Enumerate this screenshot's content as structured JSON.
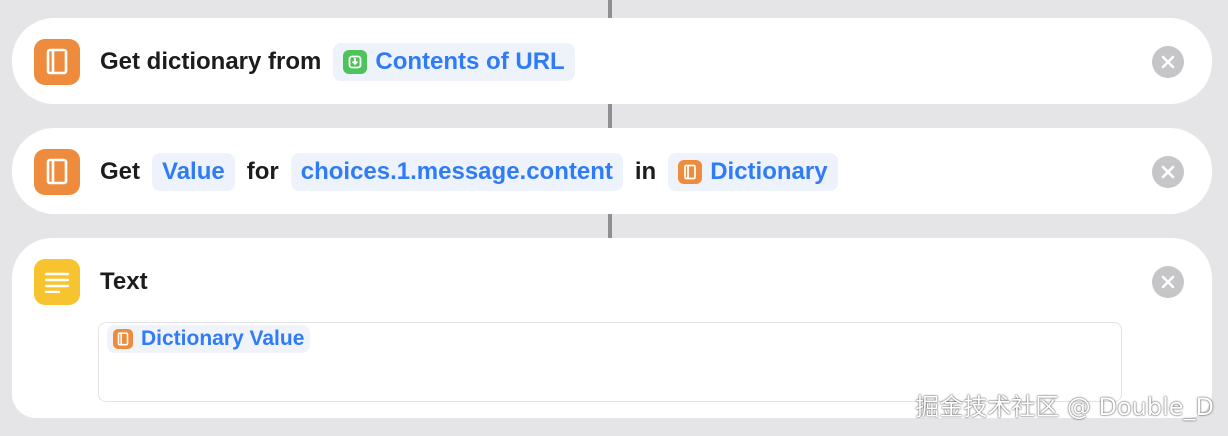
{
  "actions": [
    {
      "prefix": "Get dictionary from",
      "input_token": {
        "label": "Contents of URL",
        "icon": "url-contents-icon"
      },
      "icon": "dictionary-book-icon"
    },
    {
      "word_get": "Get",
      "mode_token": "Value",
      "word_for": "for",
      "key_token": "choices.1.message.content",
      "word_in": "in",
      "dict_token": {
        "label": "Dictionary",
        "icon": "dictionary-book-icon"
      },
      "icon": "dictionary-book-icon"
    },
    {
      "title": "Text",
      "icon": "text-lines-icon",
      "content_token": {
        "label": "Dictionary Value",
        "icon": "dictionary-book-icon"
      }
    }
  ],
  "watermark": "掘金技术社区 @ Double_D",
  "colors": {
    "background": "#e5e5e7",
    "card": "#ffffff",
    "token_text": "#2f7cf6",
    "dictionary_orange": "#ef8b3c",
    "url_green": "#4cc35b",
    "text_yellow": "#f7c32e",
    "close_gray": "#c6c6c9"
  }
}
